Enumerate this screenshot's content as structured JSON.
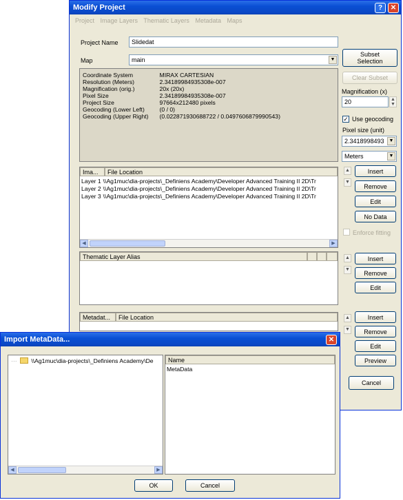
{
  "modify": {
    "title": "Modify Project",
    "help": "?",
    "close": "✕",
    "menu": [
      "Project",
      "Image Layers",
      "Thematic Layers",
      "Metadata",
      "Maps"
    ],
    "project_name_label": "Project Name",
    "project_name_value": "Slidedat",
    "map_label": "Map",
    "map_value": "main",
    "info": [
      {
        "k": "Coordinate System",
        "v": "MIRAX CARTESIAN"
      },
      {
        "k": "Resolution (Meters)",
        "v": "2.34189984935308e-007"
      },
      {
        "k": "Magnification (orig.)",
        "v": "20x (20x)"
      },
      {
        "k": "Pixel Size",
        "v": "2.34189984935308e-007"
      },
      {
        "k": "Project Size",
        "v": "97664x212480 pixels"
      },
      {
        "k": "Geocoding (Lower Left)",
        "v": "(0 / 0)"
      },
      {
        "k": "Geocoding (Upper Right)",
        "v": "(0.022871930688722 / 0.0497606879990543)"
      }
    ],
    "subset_selection": "Subset Selection",
    "clear_subset": "Clear Subset",
    "magnification_label": "Magnification (x)",
    "magnification_value": "20",
    "use_geocoding": "Use geocoding",
    "pixel_size_label": "Pixel size (unit)",
    "pixel_size_value": "2.3418998493",
    "unit_value": "Meters",
    "image_layers": {
      "headers": [
        "Ima...",
        "File Location"
      ],
      "rows": [
        {
          "layer": "Layer 1",
          "path": "\\\\Ag1muc\\dia-projects\\_Definiens Academy\\Developer Advanced Training II 2D\\Tr"
        },
        {
          "layer": "Layer 2",
          "path": "\\\\Ag1muc\\dia-projects\\_Definiens Academy\\Developer Advanced Training II 2D\\Tr"
        },
        {
          "layer": "Layer 3",
          "path": "\\\\Ag1muc\\dia-projects\\_Definiens Academy\\Developer Advanced Training II 2D\\Tr"
        }
      ]
    },
    "image_buttons": [
      "Insert",
      "Remove",
      "Edit",
      "No Data"
    ],
    "enforce_fitting": "Enforce fitting",
    "thematic_header": "Thematic Layer Alias",
    "thematic_buttons": [
      "Insert",
      "Remove",
      "Edit"
    ],
    "metadata_headers": [
      "Metadat...",
      "File Location"
    ],
    "metadata_buttons": [
      "Insert",
      "Remove",
      "Edit",
      "Preview"
    ],
    "cancel": "Cancel"
  },
  "import": {
    "title": "Import MetaData...",
    "close": "✕",
    "tree_item": "\\\\Ag1muc\\dia-projects\\_Definiens Academy\\De",
    "list_header": "Name",
    "list_item": "MetaData",
    "ok": "OK",
    "cancel": "Cancel"
  }
}
